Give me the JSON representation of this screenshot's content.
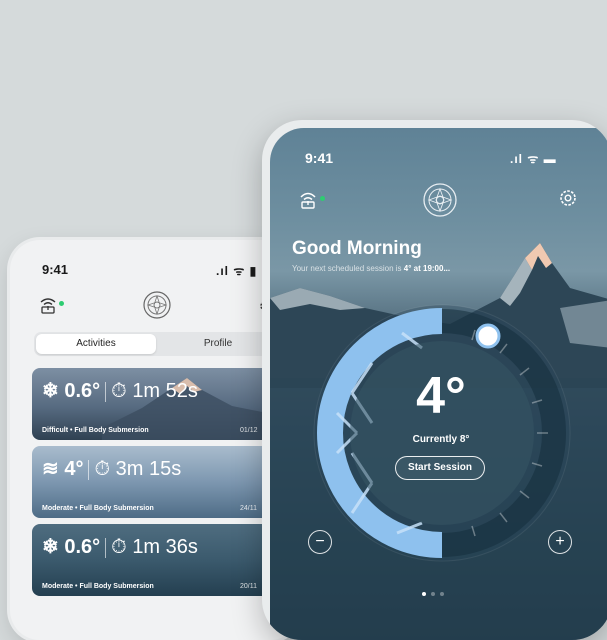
{
  "back_phone": {
    "time": "9:41",
    "status": ".ıl ᯤ ▮",
    "tabs": [
      {
        "label": "Activities",
        "active": true
      },
      {
        "label": "Profile",
        "active": false
      }
    ],
    "cards": [
      {
        "icon": "❄",
        "temp": "0.6°",
        "timer_icon": "⏱",
        "time": "1m 52s",
        "subtitle": "Difficult • Full Body Submersion",
        "date": "01/12"
      },
      {
        "icon": "≋",
        "temp": "4°",
        "timer_icon": "⏱",
        "time": "3m 15s",
        "subtitle": "Moderate • Full Body Submersion",
        "date": "24/11"
      },
      {
        "icon": "❄",
        "temp": "0.6°",
        "timer_icon": "⏱",
        "time": "1m 36s",
        "subtitle": "Moderate • Full Body Submersion",
        "date": "20/11"
      }
    ]
  },
  "front_phone": {
    "time": "9:41",
    "status": ".ıl ᯤ ▬",
    "greeting": "Good Morning",
    "next_prefix": "Your next scheduled session is ",
    "next_value": "4° at 19:00...",
    "target_temp": "4°",
    "current_temp": "Currently 8°",
    "start_button": "Start Session",
    "minus": "−",
    "plus": "+",
    "page_count": 3,
    "active_page": 0,
    "dial_fill_fraction": 0.5
  },
  "colors": {
    "background": "#d5dadb",
    "accent_blue": "#8ec1ee",
    "online_dot": "#2ecc71"
  }
}
